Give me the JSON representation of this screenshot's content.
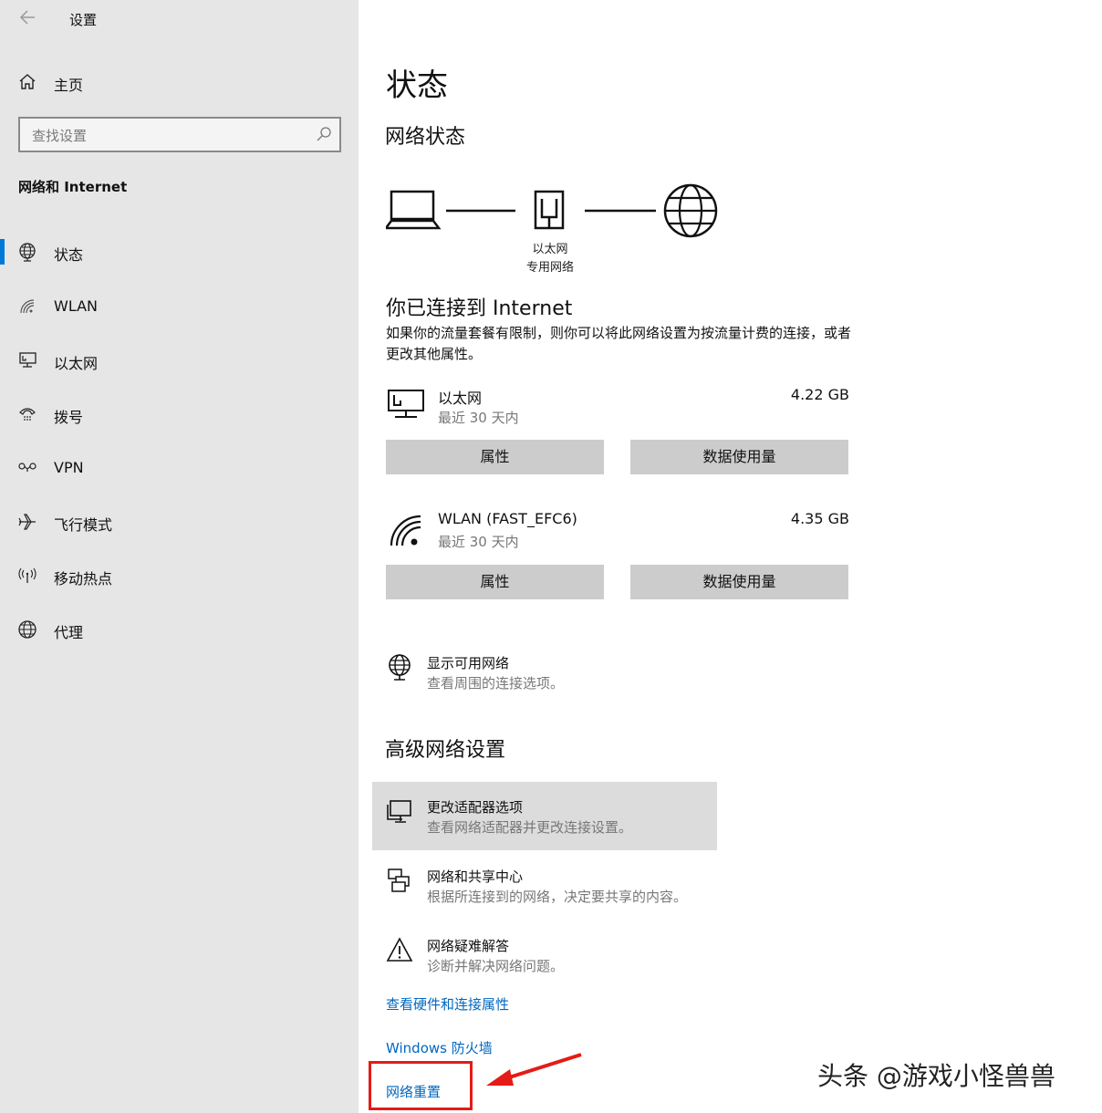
{
  "window": {
    "title": "设置"
  },
  "sidebar": {
    "home_label": "主页",
    "search_placeholder": "查找设置",
    "section_title": "网络和 Internet",
    "items": [
      {
        "label": "状态",
        "icon": "globe-status-icon",
        "selected": true
      },
      {
        "label": "WLAN",
        "icon": "wifi-icon",
        "selected": false
      },
      {
        "label": "以太网",
        "icon": "ethernet-icon",
        "selected": false
      },
      {
        "label": "拨号",
        "icon": "dialup-icon",
        "selected": false
      },
      {
        "label": "VPN",
        "icon": "vpn-icon",
        "selected": false
      },
      {
        "label": "飞行模式",
        "icon": "airplane-icon",
        "selected": false
      },
      {
        "label": "移动热点",
        "icon": "hotspot-icon",
        "selected": false
      },
      {
        "label": "代理",
        "icon": "globe-icon",
        "selected": false
      }
    ]
  },
  "main": {
    "title": "状态",
    "network_status_heading": "网络状态",
    "diagram": {
      "caption_line1": "以太网",
      "caption_line2": "专用网络"
    },
    "connected_heading": "你已连接到 Internet",
    "connected_desc": "如果你的流量套餐有限制，则你可以将此网络设置为按流量计费的连接，或者更改其他属性。",
    "adapters": [
      {
        "name": "以太网",
        "period": "最近 30 天内",
        "usage": "4.22 GB",
        "properties_label": "属性",
        "data_usage_label": "数据使用量"
      },
      {
        "name": "WLAN (FAST_EFC6)",
        "period": "最近 30 天内",
        "usage": "4.35 GB",
        "properties_label": "属性",
        "data_usage_label": "数据使用量"
      }
    ],
    "show_networks": {
      "title": "显示可用网络",
      "desc": "查看周围的连接选项。"
    },
    "advanced_heading": "高级网络设置",
    "advanced": [
      {
        "title": "更改适配器选项",
        "desc": "查看网络适配器并更改连接设置。"
      },
      {
        "title": "网络和共享中心",
        "desc": "根据所连接到的网络，决定要共享的内容。"
      },
      {
        "title": "网络疑难解答",
        "desc": "诊断并解决网络问题。"
      }
    ],
    "links": {
      "hardware": "查看硬件和连接属性",
      "firewall": "Windows 防火墙",
      "reset": "网络重置"
    }
  },
  "overlay": {
    "watermark": "头条 @游戏小怪兽兽",
    "highlight_color": "#e41b17"
  },
  "colors": {
    "accent": "#0078d7",
    "link": "#0067c0",
    "sidebar_bg": "#e6e6e6",
    "button_bg": "#cccccc"
  }
}
